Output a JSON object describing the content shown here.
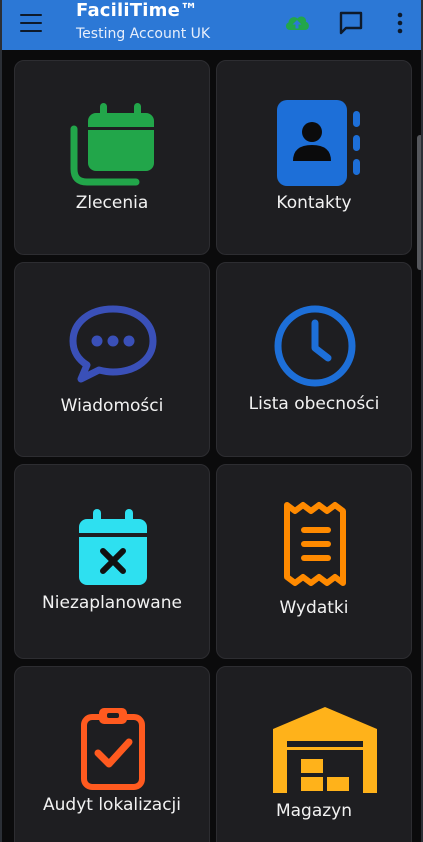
{
  "appbar": {
    "title": "FaciliTime™",
    "subtitle": "Testing Account UK",
    "icons": [
      "menu-icon",
      "cloud-upload-icon",
      "chat-icon",
      "more-vertical-icon"
    ]
  },
  "tiles": [
    {
      "label": "Zlecenia",
      "icon": "calendar-stack-icon",
      "color": "#22a64a"
    },
    {
      "label": "Kontakty",
      "icon": "contact-book-icon",
      "color": "#1d6fd8"
    },
    {
      "label": "Wiadomości",
      "icon": "chat-bubble-icon",
      "color": "#3a50b8"
    },
    {
      "label": "Lista obecności",
      "icon": "clock-icon",
      "color": "#1d6fd8"
    },
    {
      "label": "Niezaplanowane",
      "icon": "calendar-cancel-icon",
      "color": "#2ee0f0"
    },
    {
      "label": "Wydatki",
      "icon": "receipt-icon",
      "color": "#ff8a00"
    },
    {
      "label": "Audyt lokalizacji",
      "icon": "clipboard-check-icon",
      "color": "#ff5a1f"
    },
    {
      "label": "Magazyn",
      "icon": "warehouse-icon",
      "color": "#ffb21a"
    }
  ],
  "colors": {
    "appbar": "#2c78d6",
    "background": "#0b0b0c",
    "tile": "#1e1e21",
    "cloud_accent": "#22a64a"
  }
}
